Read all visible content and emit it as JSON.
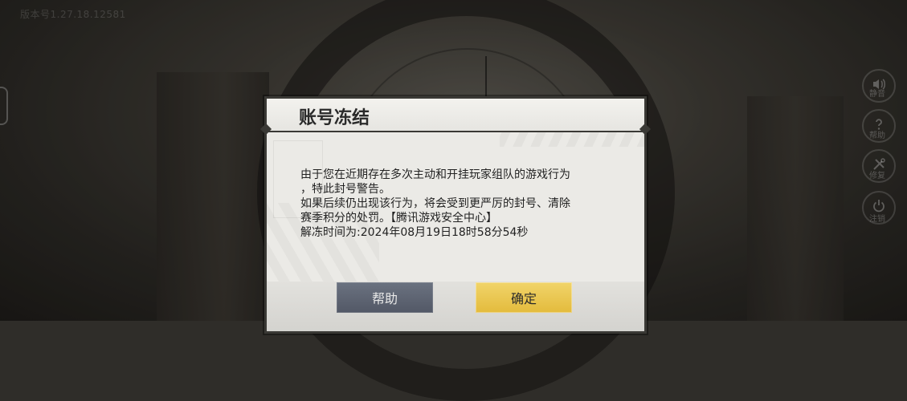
{
  "version_text": "版本号1.27.18.12581",
  "dialog": {
    "title": "账号冻结",
    "lines": [
      "由于您在近期存在多次主动和开挂玩家组队的游戏行为",
      "，特此封号警告。",
      "如果后续仍出现该行为，将会受到更严厉的封号、清除",
      "赛季积分的处罚。【腾讯游戏安全中心】",
      "解冻时间为:2024年08月19日18时58分54秒"
    ],
    "buttons": {
      "help_label": "帮助",
      "confirm_label": "确定"
    }
  },
  "side_buttons": [
    {
      "icon": "speaker-icon",
      "label": "静音"
    },
    {
      "icon": "question-icon",
      "label": "帮助"
    },
    {
      "icon": "tools-icon",
      "label": "修复"
    },
    {
      "icon": "power-icon",
      "label": "注销"
    }
  ],
  "colors": {
    "confirm_button": "#e9c44a",
    "help_button": "#5e6472",
    "dialog_bg": "#ebeae6"
  }
}
